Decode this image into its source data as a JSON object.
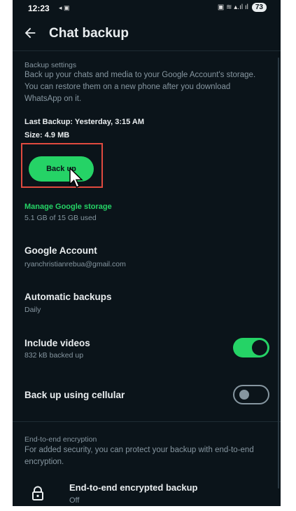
{
  "status": {
    "time": "12:23",
    "left_icons": "◂ ▣",
    "right_icons": "▣ ≋ ▴.ıl ıl",
    "battery": "73"
  },
  "header": {
    "back_icon": "arrow-left-icon",
    "title": "Chat backup"
  },
  "backup_settings": {
    "label": "Backup settings",
    "description": "Back up your chats and media to your Google Account's storage. You can restore them on a new phone after you download WhatsApp on it.",
    "last_backup": "Last Backup: Yesterday, 3:15 AM",
    "size": "Size: 4.9 MB",
    "backup_button": "Back up"
  },
  "storage": {
    "manage_link": "Manage Google storage",
    "usage": "5.1 GB of 15 GB used"
  },
  "settings": [
    {
      "title": "Google Account",
      "subtitle": "ryanchristianrebua@gmail.com"
    },
    {
      "title": "Automatic backups",
      "subtitle": "Daily"
    },
    {
      "title": "Include videos",
      "subtitle": "832 kB backed up",
      "toggle": true
    },
    {
      "title": "Back up using cellular",
      "toggle": false
    }
  ],
  "encryption": {
    "label": "End-to-end encryption",
    "description": "For added security, you can protect your backup with end-to-end encryption.",
    "item_title": "End-to-end encrypted backup",
    "item_status": "Off",
    "icon": "lock-icon"
  },
  "colors": {
    "accent": "#25d366",
    "background": "#0b141a",
    "highlight": "#e04a3f"
  }
}
